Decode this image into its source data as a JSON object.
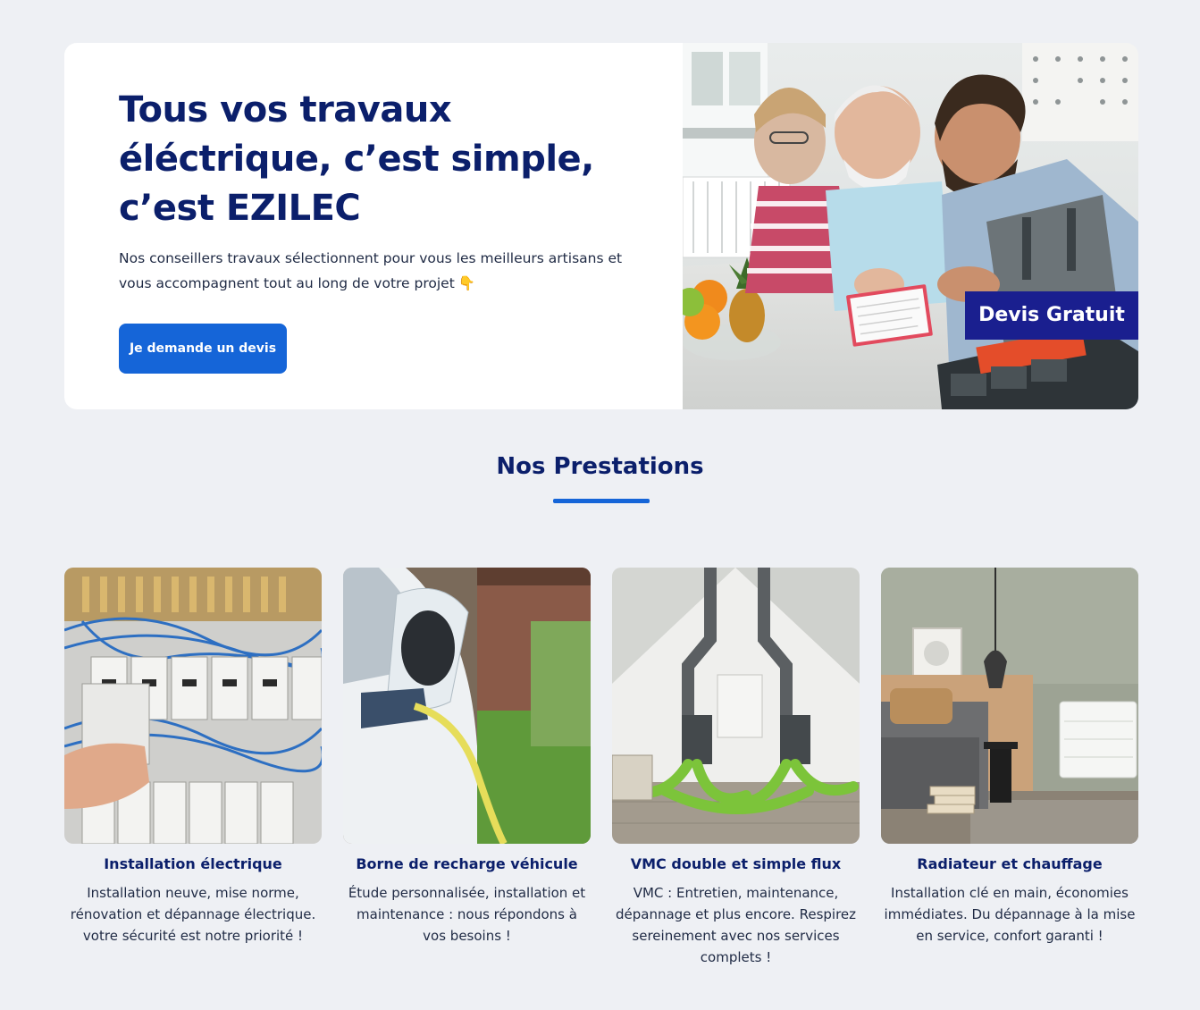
{
  "hero": {
    "title": "Tous vos travaux éléctrique, c’est simple, c’est EZILEC",
    "subtitle": "Nos conseillers travaux sélectionnent pour vous les meilleurs artisans et vous accompagnent tout au long de votre projet",
    "emoji": "👇",
    "cta_label": "Je demande un devis",
    "badge_label": "Devis Gratuit"
  },
  "services": {
    "title": "Nos Prestations",
    "cards": [
      {
        "title": "Installation électrique",
        "text": "Installation neuve, mise norme, rénovation et dépannage électrique. votre sécurité est notre priorité !"
      },
      {
        "title": "Borne de recharge véhicule",
        "text": "Étude personnalisée, installation et maintenance : nous répondons à vos besoins !"
      },
      {
        "title": "VMC double et simple flux",
        "text": "VMC : Entretien, maintenance, dépannage et plus encore. Respirez sereinement avec nos services complets !"
      },
      {
        "title": "Radiateur et chauffage",
        "text": "Installation clé en main, économies immédiates. Du dépannage à la mise en service, confort garanti !"
      }
    ]
  },
  "colors": {
    "page_background": "#eef0f4",
    "navy": "#0b1f6b",
    "accent_blue": "#1565d8",
    "badge_blue": "#1a1f8f"
  }
}
